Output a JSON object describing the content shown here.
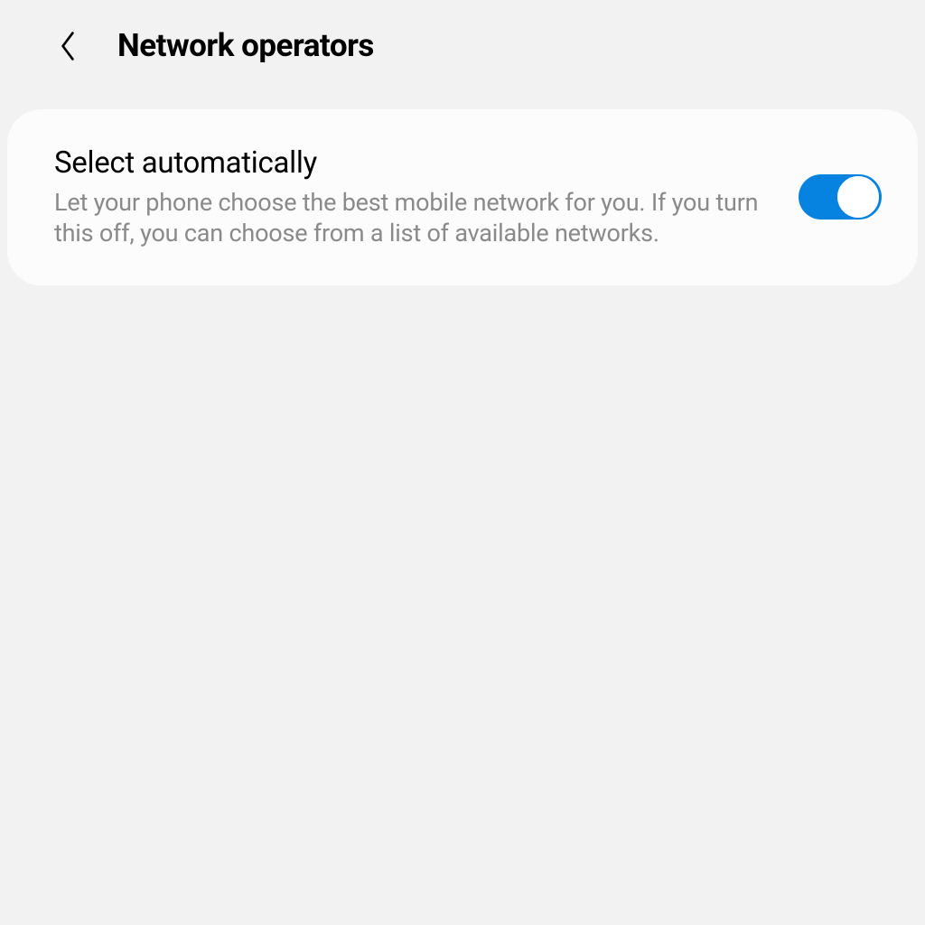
{
  "header": {
    "title": "Network operators"
  },
  "settings": {
    "selectAuto": {
      "title": "Select automatically",
      "description": "Let your phone choose the best mobile network for you. If you turn this off, you can choose from a list of available networks.",
      "enabled": true
    }
  },
  "colors": {
    "accent": "#0683e0",
    "background": "#f2f2f2",
    "cardBackground": "#fcfcfc",
    "textSecondary": "#8a8a8a"
  }
}
